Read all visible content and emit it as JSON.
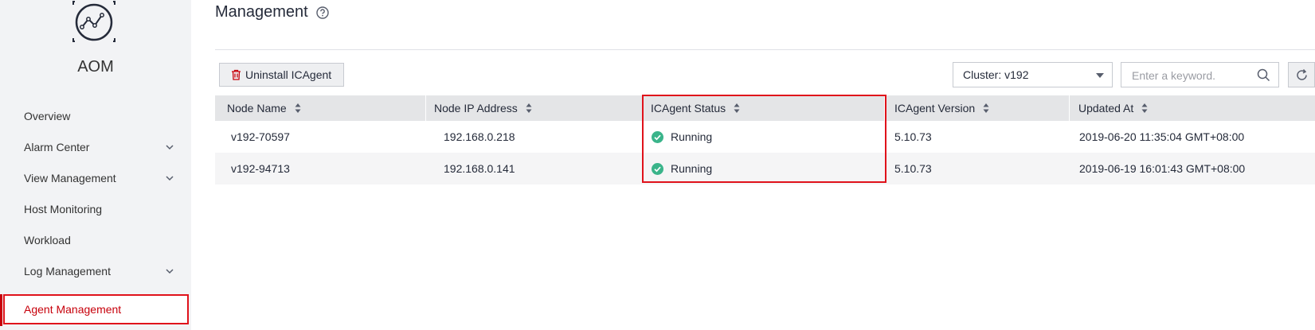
{
  "sidebar": {
    "app_title": "AOM",
    "items": [
      {
        "label": "Overview"
      },
      {
        "label": "Alarm Center"
      },
      {
        "label": "View Management"
      },
      {
        "label": "Host Monitoring"
      },
      {
        "label": "Workload"
      },
      {
        "label": "Log Management"
      },
      {
        "label": "Agent Management"
      }
    ]
  },
  "main": {
    "title": "Management",
    "toolbar": {
      "uninstall_label": "Uninstall ICAgent",
      "cluster_select": "Cluster: v192",
      "search_placeholder": "Enter a keyword."
    },
    "table": {
      "columns": [
        "Node Name",
        "Node IP Address",
        "ICAgent Status",
        "ICAgent Version",
        "Updated At"
      ],
      "rows": [
        {
          "name": "v192-70597",
          "ip": "192.168.0.218",
          "status": "Running",
          "version": "5.10.73",
          "updated": "2019-06-20 11:35:04 GMT+08:00"
        },
        {
          "name": "v192-94713",
          "ip": "192.168.0.141",
          "status": "Running",
          "version": "5.10.73",
          "updated": "2019-06-19 16:01:43 GMT+08:00"
        }
      ]
    }
  },
  "icons": {
    "logo": "aom-logo-icon",
    "help": "help-icon",
    "trash": "trash-icon",
    "search": "search-icon",
    "refresh": "refresh-icon",
    "status_ok": "check-circle-icon",
    "sort": "sort-icon",
    "chevron": "chevron-down-icon"
  },
  "colors": {
    "accent": "#c7000b",
    "highlight_border": "#e0121b",
    "status_running": "#3ab48a",
    "sidebar_bg": "#f2f3f5",
    "table_header_bg": "#e4e5e7"
  }
}
